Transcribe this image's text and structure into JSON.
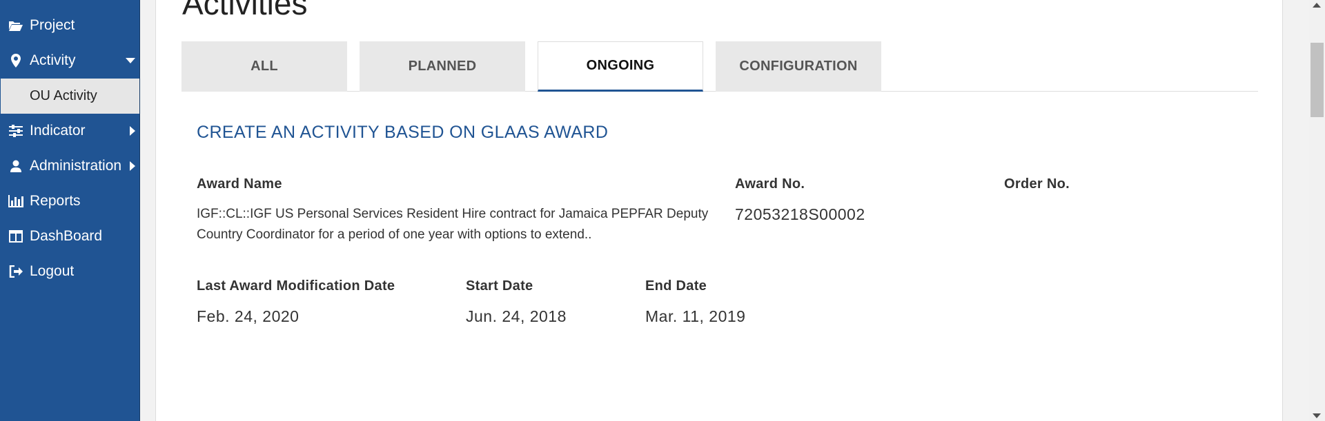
{
  "sidebar": {
    "items": [
      {
        "label": "Project",
        "icon": "folder-open-icon"
      },
      {
        "label": "Activity",
        "icon": "map-marker-icon"
      },
      {
        "label": "Indicator",
        "icon": "sliders-icon"
      },
      {
        "label": "Administration",
        "icon": "user-icon"
      },
      {
        "label": "Reports",
        "icon": "bar-chart-icon"
      },
      {
        "label": "DashBoard",
        "icon": "columns-icon"
      },
      {
        "label": "Logout",
        "icon": "sign-out-icon"
      }
    ],
    "sub_item": "OU Activity"
  },
  "page": {
    "title": "Activities"
  },
  "tabs": [
    {
      "label": "ALL",
      "active": false
    },
    {
      "label": "PLANNED",
      "active": false
    },
    {
      "label": "ONGOING",
      "active": true
    },
    {
      "label": "CONFIGURATION",
      "active": false
    }
  ],
  "section": {
    "title": "CREATE AN ACTIVITY BASED ON GLAAS AWARD"
  },
  "award": {
    "name_label": "Award Name",
    "name_value": "IGF::CL::IGF US Personal Services Resident Hire contract for Jamaica PEPFAR Deputy Country Coordinator for a period of one year with options to extend..",
    "number_label": "Award No.",
    "number_value": "72053218S00002",
    "order_label": "Order No.",
    "order_value": "",
    "mod_date_label": "Last Award Modification Date",
    "mod_date_value": "Feb. 24, 2020",
    "start_label": "Start Date",
    "start_value": "Jun. 24, 2018",
    "end_label": "End Date",
    "end_value": "Mar. 11, 2019"
  },
  "colors": {
    "sidebar_bg": "#205493",
    "accent": "#205493",
    "tab_inactive_bg": "#e8e8e8"
  }
}
